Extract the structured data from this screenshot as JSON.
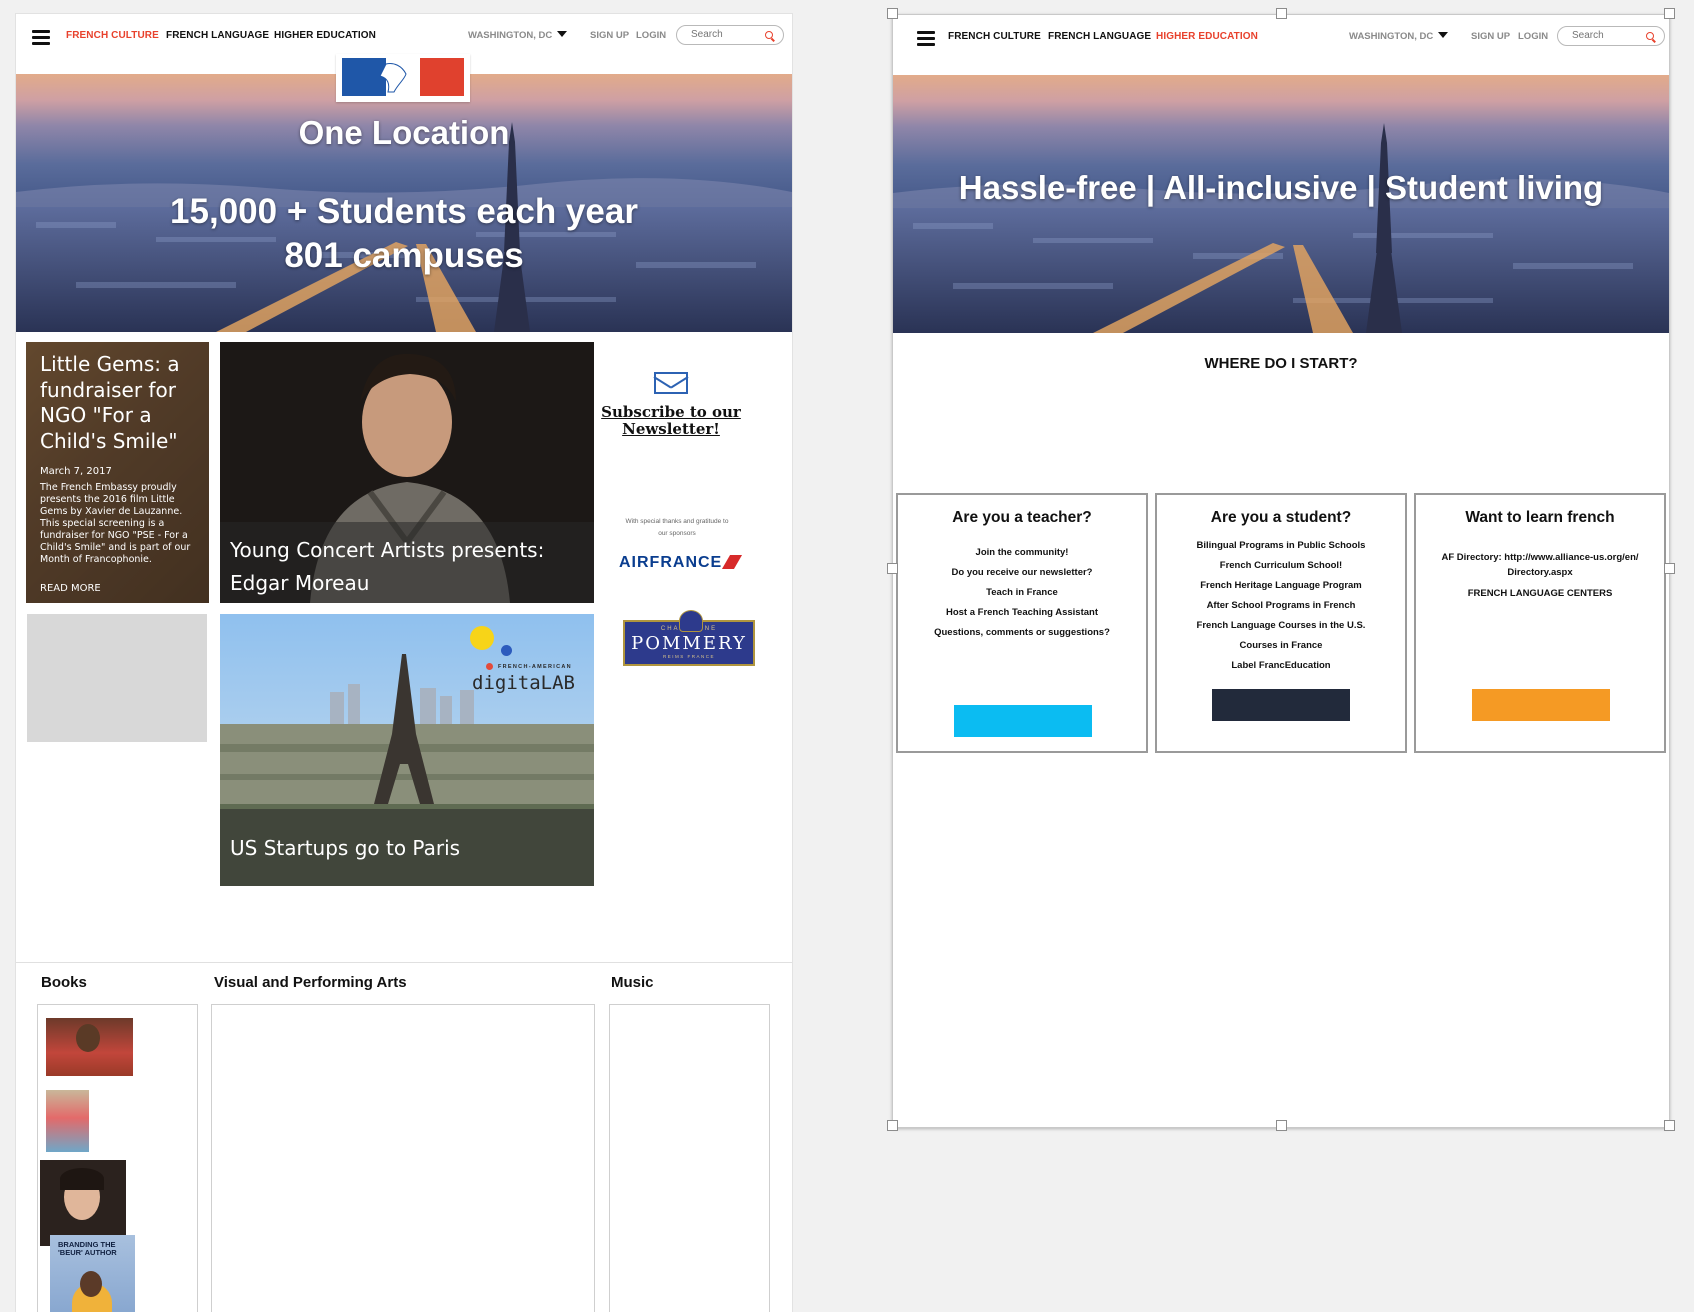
{
  "colors": {
    "accent_red": "#e8412c",
    "cta_blue": "#0bbcf2",
    "cta_navy": "#222a3b",
    "cta_orange": "#f59a24"
  },
  "left": {
    "nav": {
      "links": [
        "FRENCH CULTURE",
        "FRENCH LANGUAGE",
        "HIGHER EDUCATION"
      ],
      "active_index": 0,
      "location": "WASHINGTON, DC",
      "sign_up": "SIGN UP",
      "login": "LOGIN",
      "search_placeholder": "Search"
    },
    "hero": {
      "line1": "One Location",
      "line2": "15,000 + Students each year",
      "line3": "801 campuses"
    },
    "feature": {
      "title": "Little Gems: a fundraiser for NGO \"For a Child's Smile\"",
      "date": "March 7, 2017",
      "body": "The French Embassy proudly presents the 2016 film Little Gems by Xavier de Lauzanne. This special screening is a fundraiser for NGO \"PSE - For a Child's Smile\" and is part of our Month of Francophonie.",
      "read_more": "READ MORE"
    },
    "concert": {
      "title": "Young Concert Artists presents: Edgar Moreau"
    },
    "startups": {
      "title": "US Startups go to Paris",
      "badge_small": "FRENCH-AMERICAN",
      "badge_big": "digitaLAB"
    },
    "newsletter": "Subscribe to our Newsletter!",
    "sponsors_note": "With special thanks and gratitude to our sponsors",
    "airfrance": "AIRFRANCE",
    "pommery": {
      "top": "CHAMPAGNE",
      "word": "POMMERY",
      "sub": "REIMS FRANCE"
    },
    "columns": [
      "Books",
      "Visual and Performing Arts",
      "Music"
    ],
    "books_cover_text": "BRANDING THE 'BEUR' AUTHOR"
  },
  "right": {
    "nav": {
      "links": [
        "FRENCH CULTURE",
        "FRENCH LANGUAGE",
        "HIGHER EDUCATION"
      ],
      "active_index": 2,
      "location": "WASHINGTON, DC",
      "sign_up": "SIGN UP",
      "login": "LOGIN",
      "search_placeholder": "Search"
    },
    "hero": {
      "line1": "Hassle-free | All-inclusive | Student living"
    },
    "where_title": "WHERE DO I START?",
    "cards": [
      {
        "title": "Are you a teacher?",
        "items": [
          "Join the community!",
          "Do you receive our newsletter?",
          "Teach in France",
          "Host a French Teaching Assistant",
          "Questions, comments or suggestions?"
        ],
        "cta_color": "#0bbcf2"
      },
      {
        "title": "Are you a student?",
        "items": [
          "Bilingual Programs in Public Schools",
          "French Curriculum School!",
          "French Heritage Language Program",
          "After School Programs in French",
          "French Language Courses in the U.S.",
          "Courses in France",
          "Label FrancEducation"
        ],
        "cta_color": "#222a3b"
      },
      {
        "title": "Want to learn french",
        "items": [
          "AF Directory: http://www.alliance-us.org/en/ Directory.aspx",
          "FRENCH LANGUAGE CENTERS"
        ],
        "cta_color": "#f59a24"
      }
    ]
  }
}
